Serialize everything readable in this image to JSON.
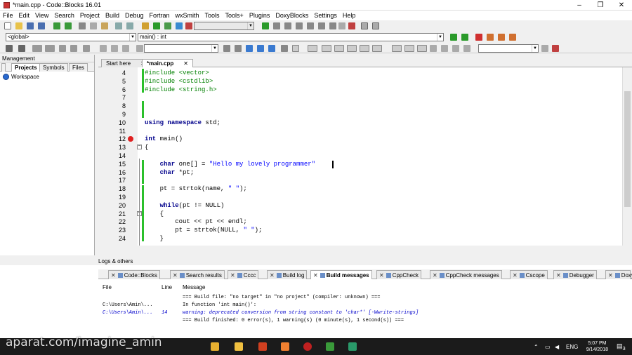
{
  "window": {
    "title": "*main.cpp - Code::Blocks 16.01",
    "minimize": "–",
    "maximize": "❐",
    "close": "✕"
  },
  "menu": [
    "File",
    "Edit",
    "View",
    "Search",
    "Project",
    "Build",
    "Debug",
    "Fortran",
    "wxSmith",
    "Tools",
    "Tools+",
    "Plugins",
    "DoxyBlocks",
    "Settings",
    "Help"
  ],
  "toolbar2": {
    "scope_value": "<global>",
    "function_value": "main() : int"
  },
  "management": {
    "title": "Management",
    "tabs": [
      "Projects",
      "Symbols",
      "Files"
    ],
    "workspace": "Workspace"
  },
  "editor_tabs": [
    {
      "label": "Start here"
    },
    {
      "label": "*main.cpp"
    }
  ],
  "editor_tab_close": "✕",
  "code_lines": [
    {
      "n": "4",
      "text": "#include <vector>"
    },
    {
      "n": "5",
      "text": "#include <cstdlib>"
    },
    {
      "n": "6",
      "text": "#include <string.h>"
    },
    {
      "n": "7",
      "text": ""
    },
    {
      "n": "8",
      "text": ""
    },
    {
      "n": "9",
      "text": ""
    },
    {
      "n": "10",
      "text": "using namespace std;"
    },
    {
      "n": "11",
      "text": ""
    },
    {
      "n": "12",
      "text": "int main()"
    },
    {
      "n": "13",
      "text": "{"
    },
    {
      "n": "14",
      "text": ""
    },
    {
      "n": "15",
      "text": "    char one[] = \"Hello my lovely programmer\""
    },
    {
      "n": "16",
      "text": "    char *pt;"
    },
    {
      "n": "17",
      "text": ""
    },
    {
      "n": "18",
      "text": "    pt = strtok(name, \" \");"
    },
    {
      "n": "19",
      "text": ""
    },
    {
      "n": "20",
      "text": "    while(pt != NULL)"
    },
    {
      "n": "21",
      "text": "    {"
    },
    {
      "n": "22",
      "text": "        cout << pt << endl;"
    },
    {
      "n": "23",
      "text": "        pt = strtok(NULL, \" \");"
    },
    {
      "n": "24",
      "text": "    }"
    }
  ],
  "logs": {
    "title": "Logs & others",
    "tabs": [
      "Code::Blocks",
      "Search results",
      "Cccc",
      "Build log",
      "Build messages",
      "CppCheck",
      "CppCheck messages",
      "Cscope",
      "Debugger",
      "DoxyB"
    ],
    "columns": [
      "File",
      "Line",
      "Message"
    ],
    "rows": [
      {
        "file": "",
        "line": "",
        "message": "=== Build file: \"no target\" in \"no project\" (compiler: unknown) ===",
        "type": "info"
      },
      {
        "file": "C:\\Users\\Amin\\...",
        "line": "",
        "message": "In function 'int main()':",
        "type": "info"
      },
      {
        "file": "C:\\Users\\Amin\\...",
        "line": "14",
        "message": "warning: deprecated conversion from string constant to 'char*' [-Wwrite-strings]",
        "type": "warning"
      },
      {
        "file": "",
        "line": "",
        "message": "=== Build finished: 0 error(s), 1 warning(s) (0 minute(s), 1 second(s)) ===",
        "type": "info"
      }
    ]
  },
  "taskbar": {
    "time": "5:07 PM",
    "date": "9/14/2018",
    "lang": "ENG",
    "notifications": "3",
    "watermark": "aparat.com/imagine_amin"
  },
  "colors": {
    "keyword": "#00008b",
    "preprocessor": "#008000",
    "string": "#0000ff",
    "breakpoint": "#e02020",
    "changebar": "#2bc02b",
    "warning": "#0000cc"
  }
}
